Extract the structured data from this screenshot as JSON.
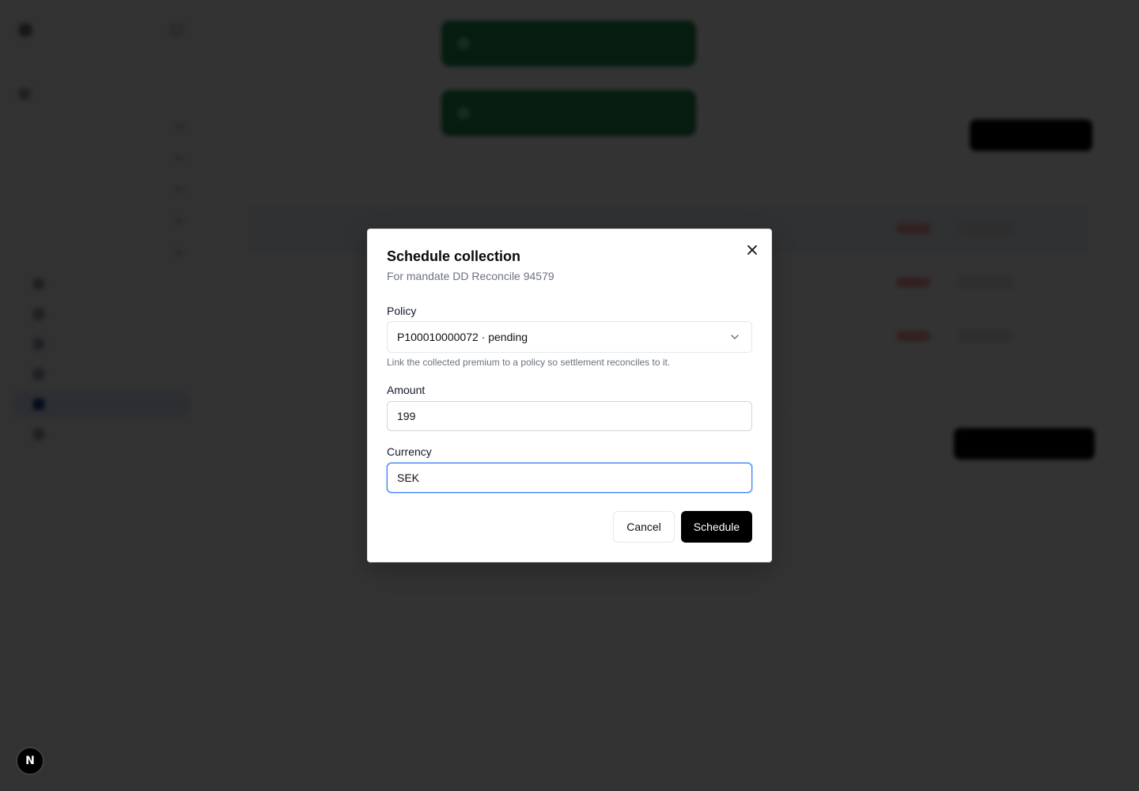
{
  "dialog": {
    "title": "Schedule collection",
    "description": "For mandate DD Reconcile 94579",
    "close_icon": "close-icon",
    "policy": {
      "label": "Policy",
      "selected": "P100010000072 · pending",
      "hint": "Link the collected premium to a policy so settlement reconciles to it."
    },
    "amount": {
      "label": "Amount",
      "value": "199"
    },
    "currency": {
      "label": "Currency",
      "value": "SEK"
    },
    "cancel_label": "Cancel",
    "submit_label": "Schedule"
  },
  "dev_badge": {
    "label": "N"
  },
  "colors": {
    "overlay": "#000000cc",
    "primary_button": "#000000",
    "focus_ring": "#3b82f6",
    "toast": "#1f8a4c"
  }
}
